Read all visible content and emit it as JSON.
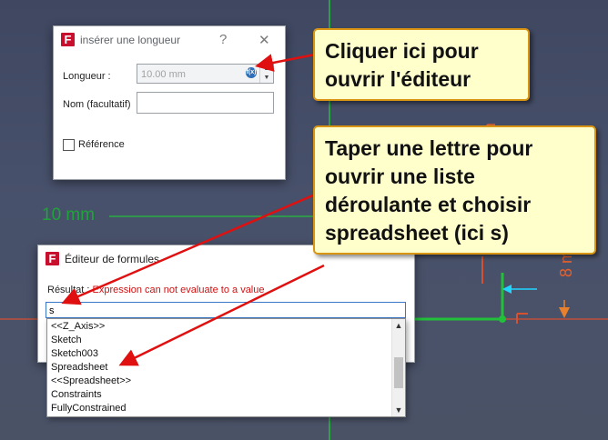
{
  "viewport": {
    "dimension_label": "10 mm",
    "dimension_right": "8 mm",
    "dimension_vertical": "m",
    "colors": {
      "background": "#454d66",
      "green_line": "#22c03a",
      "red_line": "#d85030",
      "cyan_arrow": "#20d6ff"
    }
  },
  "length_dialog": {
    "title": "insérer une longueur",
    "app_icon": "F",
    "help_label": "?",
    "close_label": "✕",
    "length_label": "Longueur :",
    "length_value": "10.00 mm",
    "fx_label": "f(x)",
    "spin_up": "▲",
    "spin_down": "▼",
    "name_label": "Nom (facultatif)",
    "name_value": "",
    "reference_label": "Référence",
    "reference_checked": false
  },
  "formula_editor": {
    "title": "Éditeur de formules",
    "app_icon": "F",
    "result_label": "Résultat :",
    "result_error": "Expression can not evaluate to a value",
    "expression_value": "s",
    "suggestions": [
      "<<Z_Axis>>",
      "Sketch",
      "Sketch003",
      "Spreadsheet",
      "<<Spreadsheet>>",
      "Constraints",
      "FullyConstrained"
    ],
    "scroll_up": "▲",
    "scroll_down": "▼"
  },
  "callouts": {
    "top": [
      "Cliquer ici pour",
      "ouvrir l'éditeur"
    ],
    "bottom": [
      "Taper une lettre pour",
      "ouvrir une liste",
      "déroulante et choisir",
      "spreadsheet (ici s)"
    ],
    "border_color": "#d89412",
    "fill_color": "#ffffcc"
  },
  "annotations": {
    "arrow_color": "#e01010"
  }
}
